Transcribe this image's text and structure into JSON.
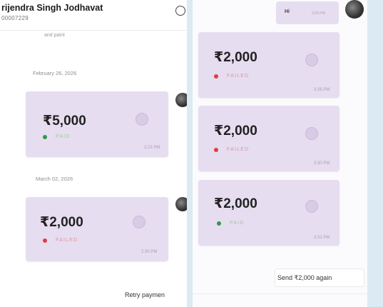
{
  "left": {
    "contact_name": "rijendra Singh  Jodhavat",
    "contact_phone": "00007229",
    "truncated_text": "and paint",
    "date1": "February 26, 2026",
    "date2": "March 02, 2026",
    "card1": {
      "amount": "₹5,000",
      "status": "PAID",
      "time": "2:23 PM"
    },
    "card2": {
      "amount": "₹2,000",
      "status": "FAILED",
      "time": "2:30 PM"
    },
    "retry_label": "Retry paymen"
  },
  "right": {
    "hi_text": "Hi",
    "hi_time": "3:25 PM",
    "cards": [
      {
        "amount": "₹2,000",
        "status": "FAILED",
        "time": "3:26 PM"
      },
      {
        "amount": "₹2,000",
        "status": "FAILED",
        "time": "3:30 PM"
      },
      {
        "amount": "₹2,000",
        "status": "PAID",
        "time": "3:31 PM"
      }
    ],
    "send_again_label": "Send ₹2,000 again"
  },
  "colors": {
    "card_bg": "#e6ddf0",
    "failed": "#e23b45",
    "paid": "#2e9a4a",
    "background": "#dceaf4"
  }
}
